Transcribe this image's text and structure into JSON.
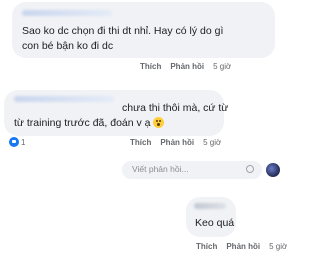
{
  "comments": [
    {
      "lines": [
        "Sao ko dc chọn đi thi dt nhỉ. Hay có lý do gì",
        "con bé bận ko đi dc"
      ],
      "like": "Thích",
      "reply": "Phản hồi",
      "time": "5 giờ"
    },
    {
      "lines": [
        "chưa thi thôi mà, cứ từ",
        "từ training trước đã, đoán v ạ"
      ],
      "like": "Thích",
      "reply": "Phản hồi",
      "time": "5 giờ",
      "reaction_count": "1"
    },
    {
      "lines": [
        "Keo quá"
      ],
      "like": "Thích",
      "reply": "Phản hồi",
      "time": "5 giờ"
    }
  ],
  "reply_box": {
    "placeholder": "Viết phản hồi..."
  },
  "icons": {
    "like": "like-icon",
    "emoji": "smile-emoji-icon",
    "avatar": "avatar"
  },
  "colors": {
    "bubble": "#f0f2f5",
    "like_blue": "#1877f2",
    "meta": "#65676b"
  }
}
